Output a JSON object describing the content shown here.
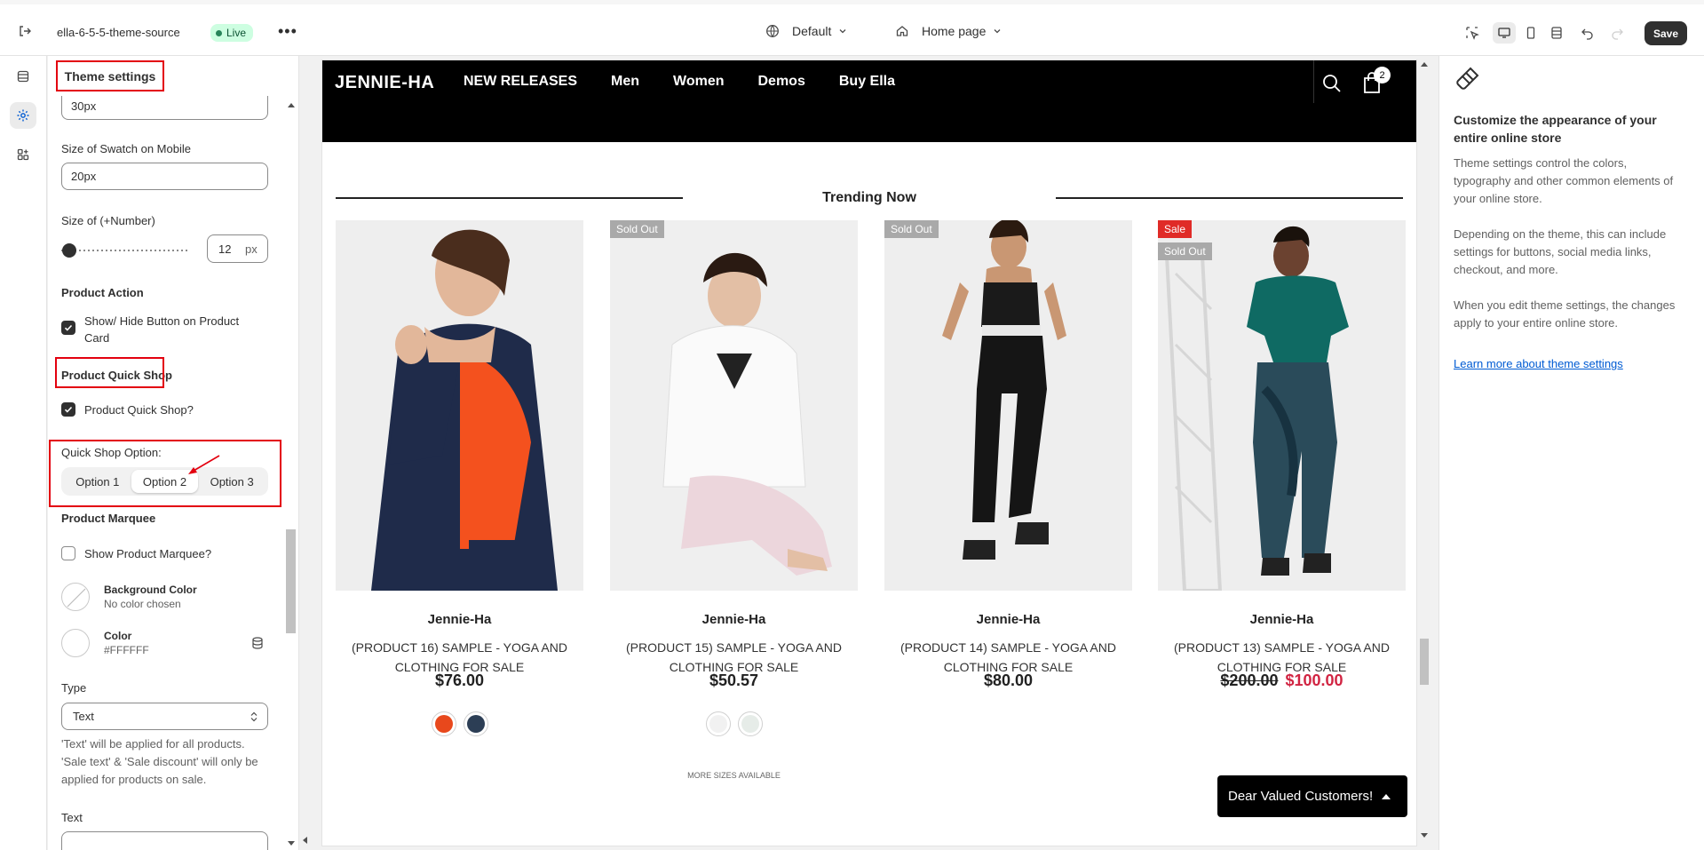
{
  "topbar": {
    "store_name": "ella-6-5-5-theme-source",
    "status": "Live",
    "more": "•••",
    "theme_selector": "Default",
    "page_selector": "Home page",
    "save_label": "Save"
  },
  "sidebar": {
    "title": "Theme settings",
    "top_input_value": "30px",
    "swatch_mobile_label": "Size of Swatch on Mobile",
    "swatch_mobile_value": "20px",
    "number_size_label": "Size of (+Number)",
    "number_size_value": "12",
    "number_size_unit": "px",
    "product_action_heading": "Product Action",
    "show_hide_button_label": "Show/ Hide Button on Product Card",
    "show_hide_button_checked": true,
    "quick_shop_heading": "Product Quick Shop",
    "quick_shop_checkbox_label": "Product Quick Shop?",
    "quick_shop_checked": true,
    "quick_shop_option_label": "Quick Shop Option:",
    "quick_shop_options": [
      "Option 1",
      "Option 2",
      "Option 3"
    ],
    "quick_shop_selected": "Option 2",
    "marquee_heading": "Product Marquee",
    "marquee_checkbox_label": "Show Product Marquee?",
    "marquee_checked": false,
    "bg_color_title": "Background Color",
    "bg_color_value": "No color chosen",
    "color_title": "Color",
    "color_value": "#FFFFFF",
    "type_label": "Type",
    "type_value": "Text",
    "type_help": "'Text' will be applied for all products. 'Sale text' & 'Sale discount' will only be applied for products on sale.",
    "text_label": "Text"
  },
  "preview": {
    "logo": "JENNIE-HA",
    "menu": [
      "NEW RELEASES",
      "Men",
      "Women",
      "Demos",
      "Buy Ella"
    ],
    "cart_count": "2",
    "section_title": "Trending Now",
    "products": [
      {
        "brand": "Jennie-Ha",
        "name": "(PRODUCT 16) SAMPLE - YOGA AND CLOTHING FOR SALE",
        "price": "$76.00",
        "badges": [],
        "swatches": [
          "#e8481c",
          "#2c3e55"
        ]
      },
      {
        "brand": "Jennie-Ha",
        "name": "(PRODUCT 15) SAMPLE - YOGA AND CLOTHING FOR SALE",
        "price": "$50.57",
        "badges": [
          "Sold Out"
        ],
        "swatches": [
          "#f1f1f1",
          "#e6ece8"
        ],
        "more_sizes": "MORE SIZES AVAILABLE"
      },
      {
        "brand": "Jennie-Ha",
        "name": "(PRODUCT 14) SAMPLE - YOGA AND CLOTHING FOR SALE",
        "price": "$80.00",
        "badges": [
          "Sold Out"
        ],
        "swatches": []
      },
      {
        "brand": "Jennie-Ha",
        "name": "(PRODUCT 13) SAMPLE - YOGA AND CLOTHING FOR SALE",
        "price_old": "$200.00",
        "price_new": "$100.00",
        "badges": [
          "Sale",
          "Sold Out"
        ],
        "swatches": []
      }
    ],
    "toast": "Dear Valued Customers!"
  },
  "right_panel": {
    "heading": "Customize the appearance of your entire online store",
    "p1": "Theme settings control the colors, typography and other common elements of your online store.",
    "p2": "Depending on the theme, this can include settings for buttons, social media links, checkout, and more.",
    "p3": "When you edit theme settings, the changes apply to your entire online store.",
    "link": "Learn more about theme settings"
  },
  "colors": {
    "highlight": "#e3000f",
    "sale_price": "#d12442",
    "sale_badge": "#e02b27",
    "sold_badge": "#a9a9a9",
    "live_badge_bg": "#cdfee1"
  }
}
